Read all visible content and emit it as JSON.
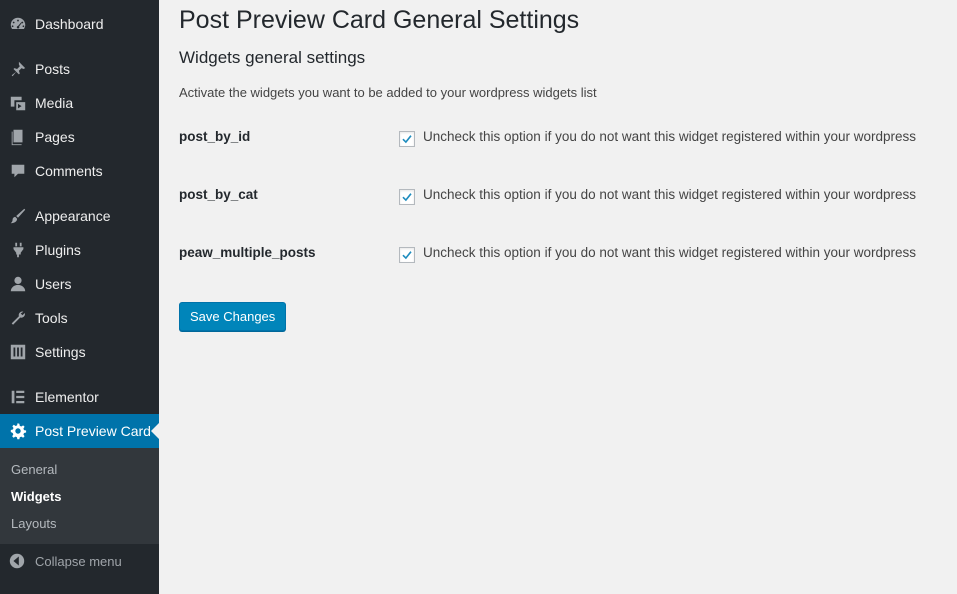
{
  "sidebar": {
    "items": [
      {
        "label": "Dashboard",
        "icon": "dashboard-icon"
      },
      {
        "label": "Posts",
        "icon": "pin-icon"
      },
      {
        "label": "Media",
        "icon": "media-icon"
      },
      {
        "label": "Pages",
        "icon": "pages-icon"
      },
      {
        "label": "Comments",
        "icon": "comment-icon"
      },
      {
        "label": "Appearance",
        "icon": "brush-icon"
      },
      {
        "label": "Plugins",
        "icon": "plug-icon"
      },
      {
        "label": "Users",
        "icon": "user-icon"
      },
      {
        "label": "Tools",
        "icon": "wrench-icon"
      },
      {
        "label": "Settings",
        "icon": "settings-sliders-icon"
      },
      {
        "label": "Elementor",
        "icon": "elementor-icon"
      },
      {
        "label": "Post Preview Card",
        "icon": "gear-icon",
        "active": true
      }
    ],
    "submenu": [
      {
        "label": "General"
      },
      {
        "label": "Widgets",
        "current": true
      },
      {
        "label": "Layouts"
      }
    ],
    "collapse_label": "Collapse menu"
  },
  "main": {
    "title": "Post Preview Card General Settings",
    "section_title": "Widgets general settings",
    "description": "Activate the widgets you want to be added to your wordpress widgets list",
    "rows": [
      {
        "label": "post_by_id",
        "checked": true,
        "text": "Uncheck this option if you do not want this widget registered within your wordpress"
      },
      {
        "label": "post_by_cat",
        "checked": true,
        "text": "Uncheck this option if you do not want this widget registered within your wordpress"
      },
      {
        "label": "peaw_multiple_posts",
        "checked": true,
        "text": "Uncheck this option if you do not want this widget registered within your wordpress"
      }
    ],
    "save_label": "Save Changes"
  },
  "colors": {
    "sidebar_bg": "#23282d",
    "active_bg": "#0073aa",
    "submenu_bg": "#32373c",
    "button_bg": "#0085ba",
    "check_color": "#1e8cbe"
  }
}
